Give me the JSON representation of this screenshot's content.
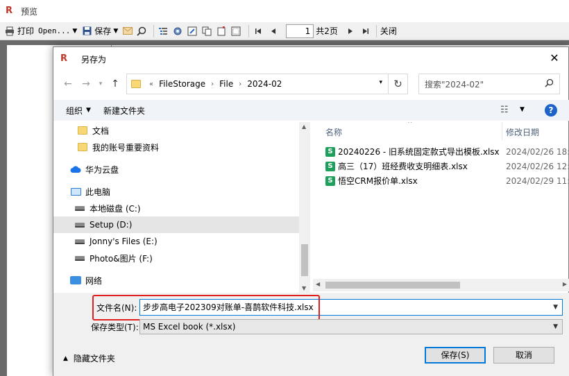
{
  "app": {
    "title": "预览",
    "toolbar": {
      "print_label": "打印",
      "open_label": "Open...",
      "save_label": "保存",
      "page_number": "1",
      "total_pages": "共2页",
      "close_label": "关闭"
    }
  },
  "dialog": {
    "title": "另存为",
    "address": {
      "crumbs": [
        "FileStorage",
        "File",
        "2024-02"
      ]
    },
    "search_placeholder": "搜索\"2024-02\"",
    "commands": {
      "organize": "组织",
      "new_folder": "新建文件夹"
    },
    "nav_items": [
      {
        "label": "文档",
        "icon": "folder-icon"
      },
      {
        "label": "我的账号重要资料",
        "icon": "folder-icon"
      },
      {
        "label": "华为云盘",
        "icon": "cloud-icon"
      },
      {
        "label": "此电脑",
        "icon": "computer-icon"
      },
      {
        "label": "本地磁盘 (C:)",
        "icon": "drive-icon"
      },
      {
        "label": "Setup (D:)",
        "icon": "drive-icon",
        "selected": true
      },
      {
        "label": "Jonny's Files (E:)",
        "icon": "drive-icon"
      },
      {
        "label": "Photo&图片 (F:)",
        "icon": "drive-icon"
      },
      {
        "label": "网络",
        "icon": "network-icon"
      }
    ],
    "columns": {
      "name": "名称",
      "date": "修改日期"
    },
    "files": [
      {
        "name": "20240226 - 旧系统固定款式导出模板.xlsx",
        "date": "2024/02/26 18:"
      },
      {
        "name": "高三（17）班经费收支明细表.xlsx",
        "date": "2024/02/26 12:"
      },
      {
        "name": "悟空CRM报价单.xlsx",
        "date": "2024/02/29 11:"
      }
    ],
    "filename_label": "文件名(N):",
    "filename_value": "步步高电子202309对账单-喜鹊软件科技.xlsx",
    "filetype_label": "保存类型(T):",
    "filetype_value": "MS Excel book (*.xlsx)",
    "hide_folders": "隐藏文件夹",
    "save_button": "保存(S)",
    "cancel_button": "取消"
  },
  "colors": {
    "accent": "#0078d7",
    "highlight": "#e02020",
    "excel": "#1f9f5c"
  }
}
